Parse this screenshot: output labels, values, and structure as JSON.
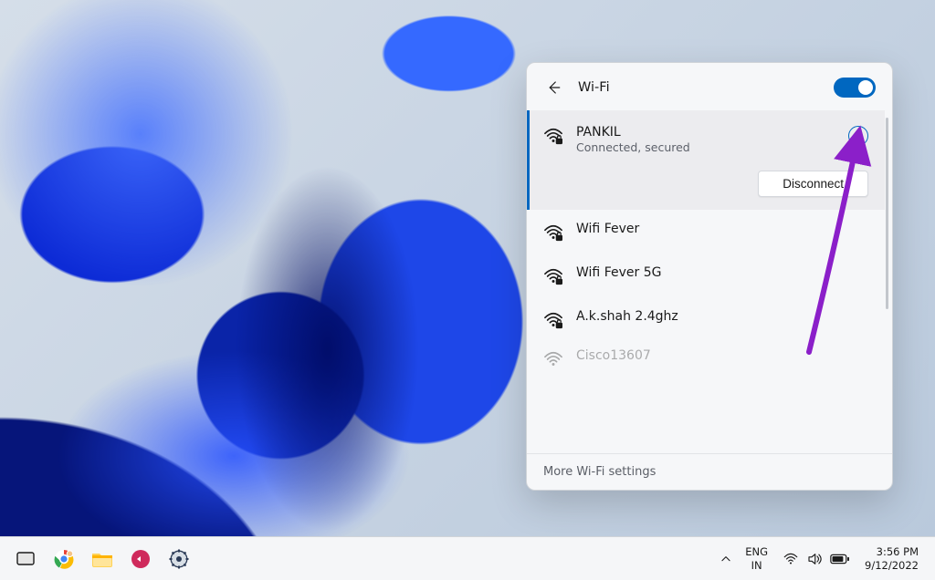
{
  "flyout": {
    "title": "Wi-Fi",
    "toggle_on": true,
    "footer": "More Wi-Fi settings"
  },
  "networks": {
    "selected": {
      "name": "PANKIL",
      "status": "Connected, secured",
      "disconnect_label": "Disconnect"
    },
    "others": [
      {
        "name": "Wifi Fever",
        "secured": true
      },
      {
        "name": "Wifi Fever 5G",
        "secured": true
      },
      {
        "name": "A.k.shah 2.4ghz",
        "secured": true
      },
      {
        "name": "Cisco13607",
        "secured": false
      }
    ]
  },
  "taskbar": {
    "language": {
      "line1": "ENG",
      "line2": "IN"
    },
    "clock": {
      "time": "3:56 PM",
      "date": "9/12/2022"
    }
  }
}
